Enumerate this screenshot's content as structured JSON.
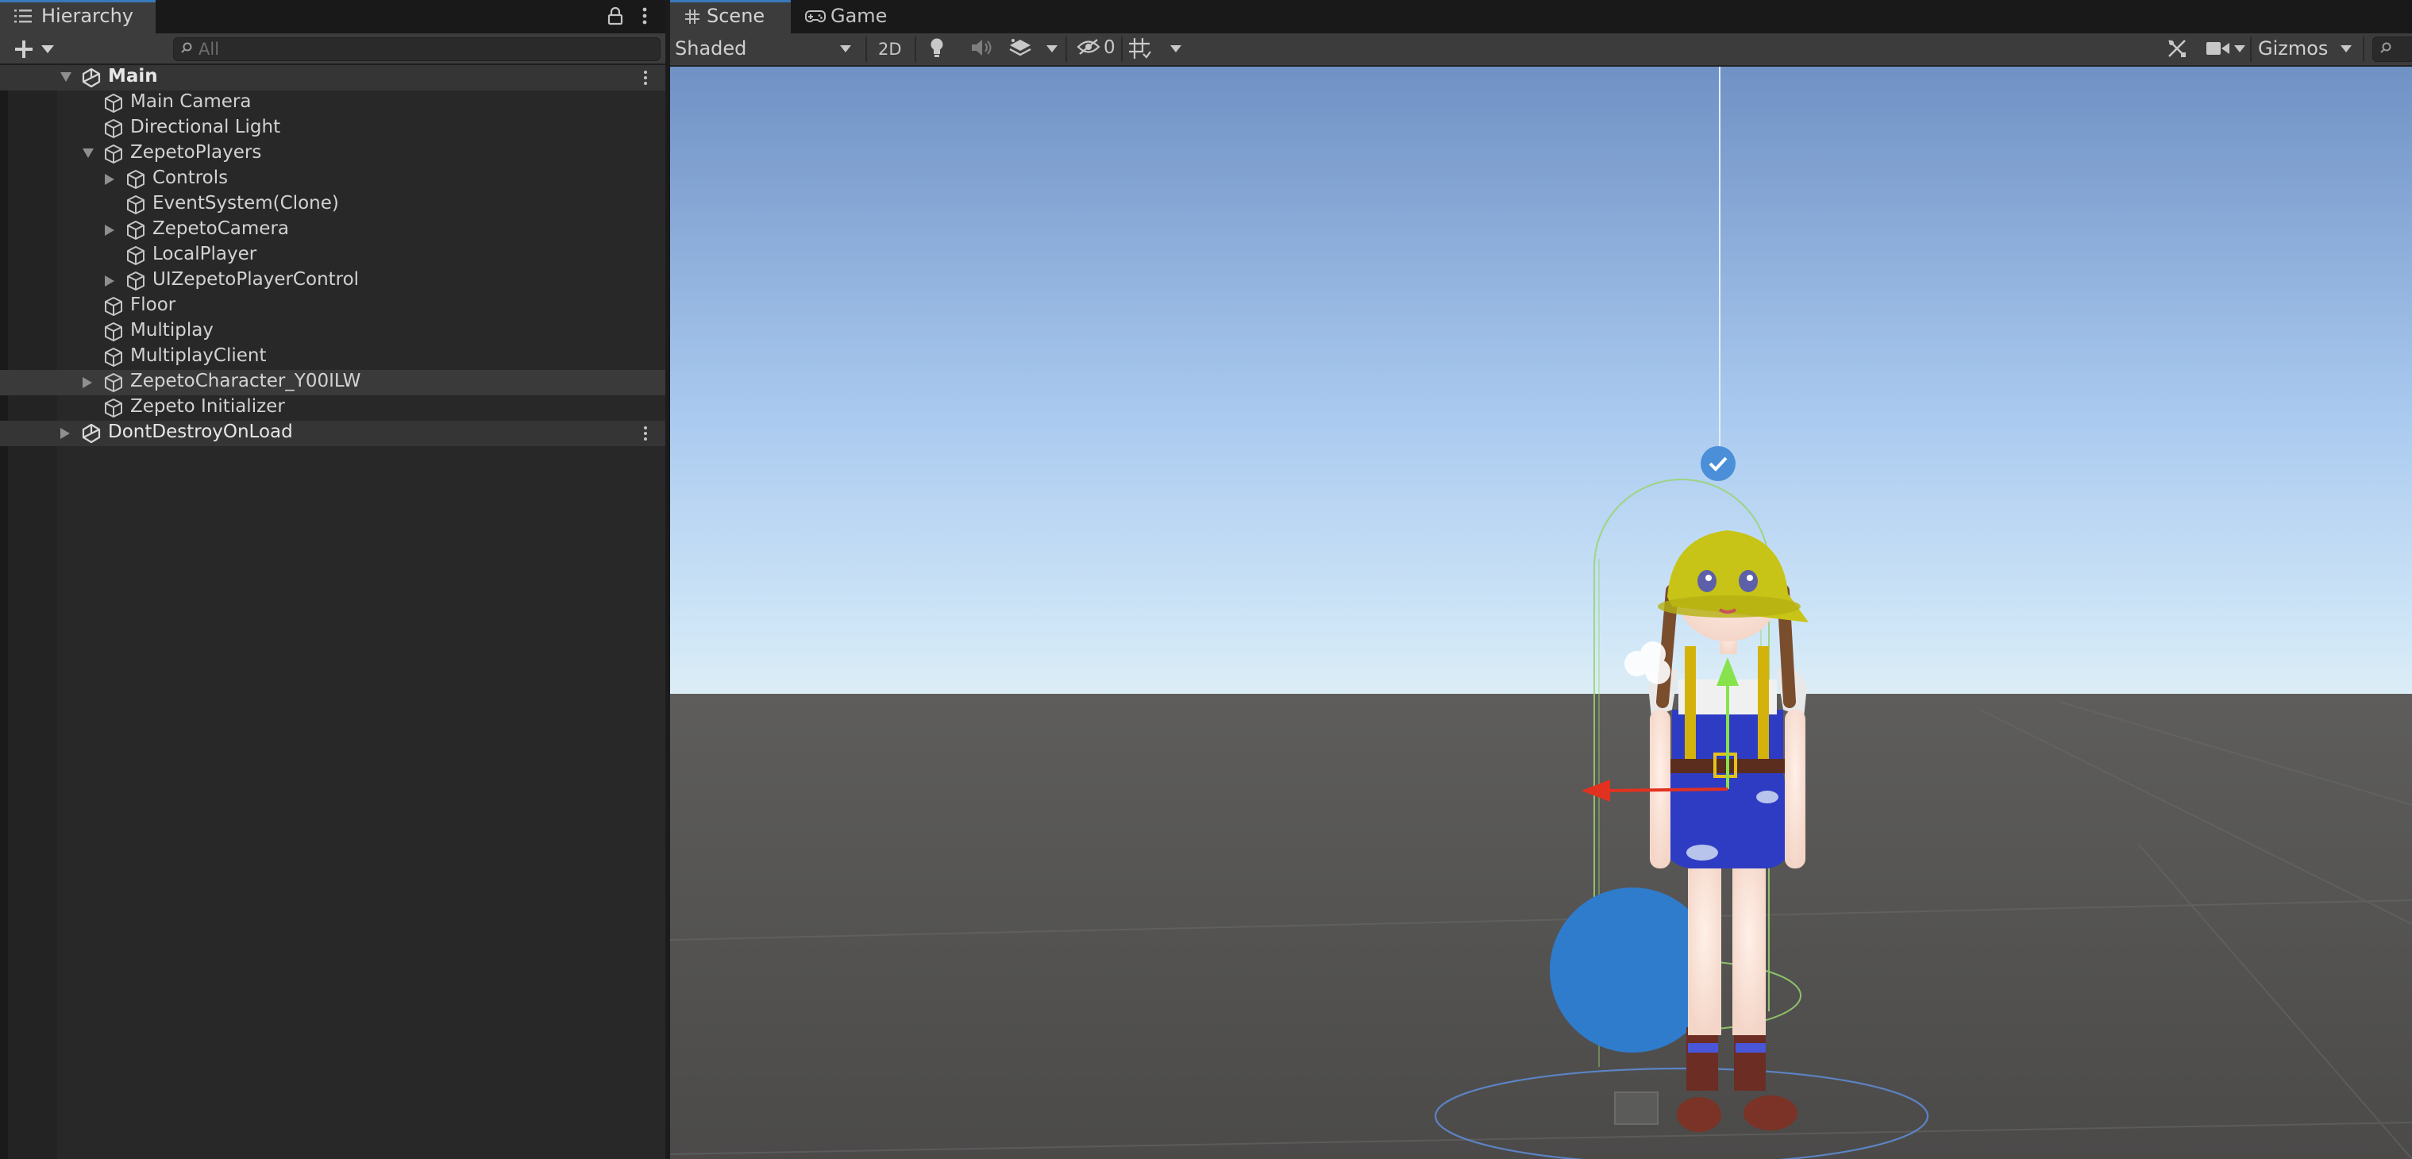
{
  "hierarchy": {
    "tab_label": "Hierarchy",
    "search_placeholder": "All",
    "rows": [
      {
        "label": "Main",
        "depth": 0,
        "kind": "scene",
        "expanded": true,
        "has_children": true
      },
      {
        "label": "Main Camera",
        "depth": 1,
        "kind": "object",
        "has_children": false
      },
      {
        "label": "Directional Light",
        "depth": 1,
        "kind": "object",
        "has_children": false
      },
      {
        "label": "ZepetoPlayers",
        "depth": 1,
        "kind": "object",
        "expanded": true,
        "has_children": true
      },
      {
        "label": "Controls",
        "depth": 2,
        "kind": "object",
        "expanded": false,
        "has_children": true
      },
      {
        "label": "EventSystem(Clone)",
        "depth": 2,
        "kind": "object",
        "has_children": false
      },
      {
        "label": "ZepetoCamera",
        "depth": 2,
        "kind": "object",
        "expanded": false,
        "has_children": true
      },
      {
        "label": "LocalPlayer",
        "depth": 2,
        "kind": "object",
        "has_children": false
      },
      {
        "label": "UIZepetoPlayerControl",
        "depth": 2,
        "kind": "object",
        "expanded": false,
        "has_children": true
      },
      {
        "label": "Floor",
        "depth": 1,
        "kind": "object",
        "has_children": false
      },
      {
        "label": "Multiplay",
        "depth": 1,
        "kind": "object",
        "has_children": false
      },
      {
        "label": "MultiplayClient",
        "depth": 1,
        "kind": "object",
        "has_children": false
      },
      {
        "label": "ZepetoCharacter_Y00ILW",
        "depth": 1,
        "kind": "object",
        "expanded": false,
        "has_children": true,
        "selected": true
      },
      {
        "label": "Zepeto Initializer",
        "depth": 1,
        "kind": "object",
        "has_children": false
      },
      {
        "label": "DontDestroyOnLoad",
        "depth": 0,
        "kind": "scene",
        "expanded": false,
        "has_children": true
      }
    ]
  },
  "scene": {
    "tabs": [
      {
        "label": "Scene",
        "icon": "grid-hash-icon",
        "active": true
      },
      {
        "label": "Game",
        "icon": "gamepad-icon",
        "active": false
      }
    ],
    "toolbar": {
      "shading_mode": "Shaded",
      "mode_2d_label": "2D",
      "hidden_objects_count": "0",
      "gizmos_label": "Gizmos"
    }
  },
  "colors": {
    "panel_bg": "#282828",
    "toolbar_bg": "#3c3c3c",
    "tab_accent": "#3a79bb",
    "sky_top": "#6f91c4",
    "sky_horizon": "#cfe6f7",
    "ground": "#555453",
    "selection_gizmo": "#98d46e",
    "transform_x_axis": "#e2321f",
    "transform_y_axis": "#86e34b"
  }
}
